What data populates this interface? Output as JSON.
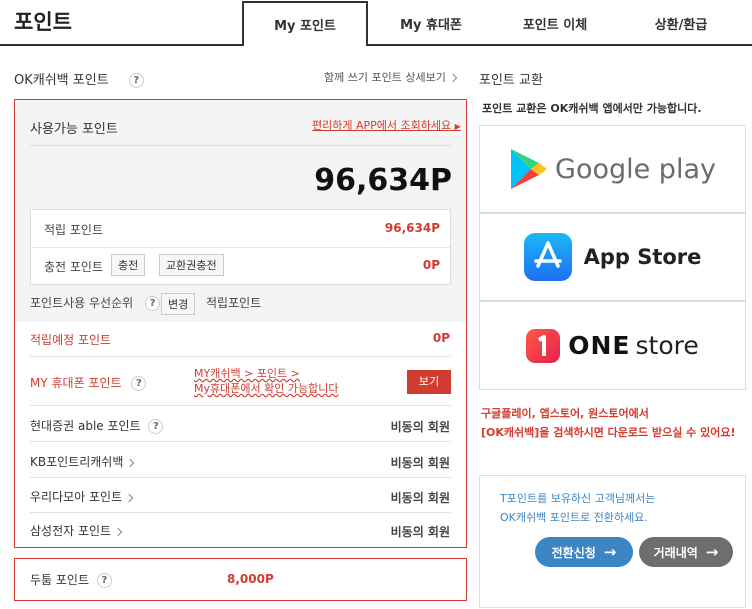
{
  "header": {
    "title": "포인트",
    "tabs": [
      {
        "label": "My 포인트"
      },
      {
        "label": "My 휴대폰"
      },
      {
        "label": "포인트 이체"
      },
      {
        "label": "상환/환급"
      }
    ]
  },
  "ok": {
    "title": "OK캐쉬백 포인트",
    "history_link": "함께 쓰기 포인트 상세보기",
    "available_label": "사용가능 포인트",
    "app_link": "편리하게 APP에서 조회하세요",
    "total": "96,634P",
    "accumulated_label": "적립 포인트",
    "accumulated_value": "96,634P",
    "charge_label": "충전 포인트",
    "charge_btn": "충전",
    "voucher_btn": "교환권충전",
    "charge_value": "0P",
    "priority_label": "포인트사용 우선순위",
    "priority_btn": "변경",
    "priority_value": "적립포인트",
    "expected_label": "적립예정 포인트",
    "expected_value": "0P",
    "phone_label": "MY 휴대폰 포인트",
    "phone_note1": "MY캐쉬백 > 포인트 >",
    "phone_note2": "My휴대폰에서 확인 가능합니다",
    "view_btn": "보기",
    "rows": [
      {
        "label": "현대증권 able 포인트",
        "value": "비동의 회원"
      },
      {
        "label": "KB포인트리캐쉬백",
        "value": "비동의 회원"
      },
      {
        "label": "우리다모아 포인트",
        "value": "비동의 회원"
      },
      {
        "label": "삼성전자 포인트",
        "value": "비동의 회원"
      }
    ]
  },
  "dutong": {
    "label": "두툼 포인트",
    "value": "8,000P"
  },
  "exchange": {
    "title": "포인트 교환",
    "notice": "포인트 교환은 OK캐쉬백 앱에서만 가능합니다.",
    "google": "Google play",
    "appstore": "App Store",
    "onestore_a": "ONE",
    "onestore_b": "store",
    "search_line1": "구글플레이, 앱스토어, 원스토어에서",
    "search_line2": "[OK캐쉬백]을 검색하시면 다운로드 받으실 수 있어요!"
  },
  "tpoint": {
    "line1": "T포인트를 보유하신 고객님께서는",
    "line2": "OK캐쉬백 포인트로 전환하세요.",
    "apply_btn": "전환신청",
    "history_btn": "거래내역",
    "apply_color": "#3d86c6",
    "history_color": "#6e6e6e"
  },
  "colors": {
    "accent": "#d23b2f",
    "border": "#d23b2f"
  }
}
